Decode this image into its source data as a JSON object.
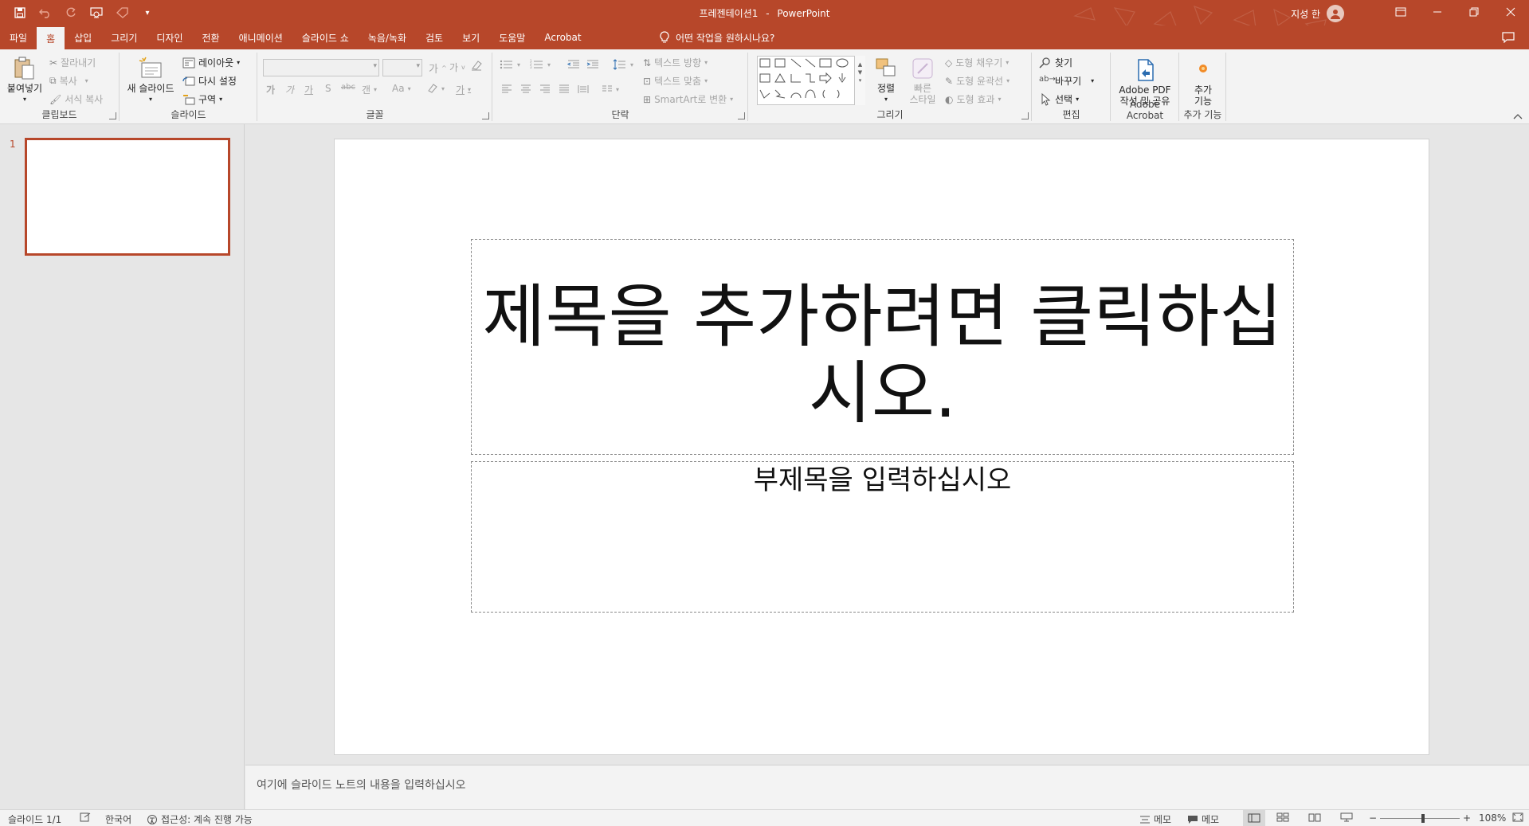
{
  "app": {
    "doc_title": "프레젠테이션1",
    "separator": "-",
    "app_name": "PowerPoint",
    "user_name": "지성 한",
    "accent_color": "#b7472a"
  },
  "tabs": [
    "파일",
    "홈",
    "삽입",
    "그리기",
    "디자인",
    "전환",
    "애니메이션",
    "슬라이드 쇼",
    "녹음/녹화",
    "검토",
    "보기",
    "도움말",
    "Acrobat"
  ],
  "active_tab": "홈",
  "tell_me": "어떤 작업을 원하시나요?",
  "ribbon": {
    "clipboard": {
      "label": "클립보드",
      "paste": "붙여넣기",
      "cut": "잘라내기",
      "copy": "복사",
      "format_painter": "서식 복사"
    },
    "slides": {
      "label": "슬라이드",
      "new_slide": "새 슬라이드",
      "layout": "레이아웃",
      "reset": "다시 설정",
      "section": "구역"
    },
    "font": {
      "label": "글꼴"
    },
    "paragraph": {
      "label": "단락",
      "text_direction": "텍스트 방향",
      "align_text": "텍스트 맞춤",
      "smartart": "SmartArt로 변환"
    },
    "drawing": {
      "label": "그리기",
      "arrange": "정렬",
      "quick_styles_1": "빠른",
      "quick_styles_2": "스타일",
      "shape_fill": "도형 채우기",
      "shape_outline": "도형 윤곽선",
      "shape_effects": "도형 효과"
    },
    "editing": {
      "label": "편집",
      "find": "찾기",
      "replace": "바꾸기",
      "select": "선택"
    },
    "acrobat": {
      "label": "Adobe Acrobat",
      "btn_line1": "Adobe PDF",
      "btn_line2": "작성 및 공유"
    },
    "addins": {
      "label": "추가 기능",
      "btn_line1": "추가",
      "btn_line2": "기능"
    }
  },
  "thumbnails": [
    {
      "number": "1"
    }
  ],
  "slide": {
    "title_placeholder": "제목을 추가하려면 클릭하십시오.",
    "subtitle_placeholder": "부제목을 입력하십시오"
  },
  "notes_placeholder": "여기에 슬라이드 노트의 내용을 입력하십시오",
  "status": {
    "slide_info": "슬라이드 1/1",
    "language": "한국어",
    "accessibility": "접근성: 계속 진행 가능",
    "notes_btn": "메모",
    "comments_btn": "메모",
    "zoom": "108%",
    "zoom_level": 0.54
  }
}
